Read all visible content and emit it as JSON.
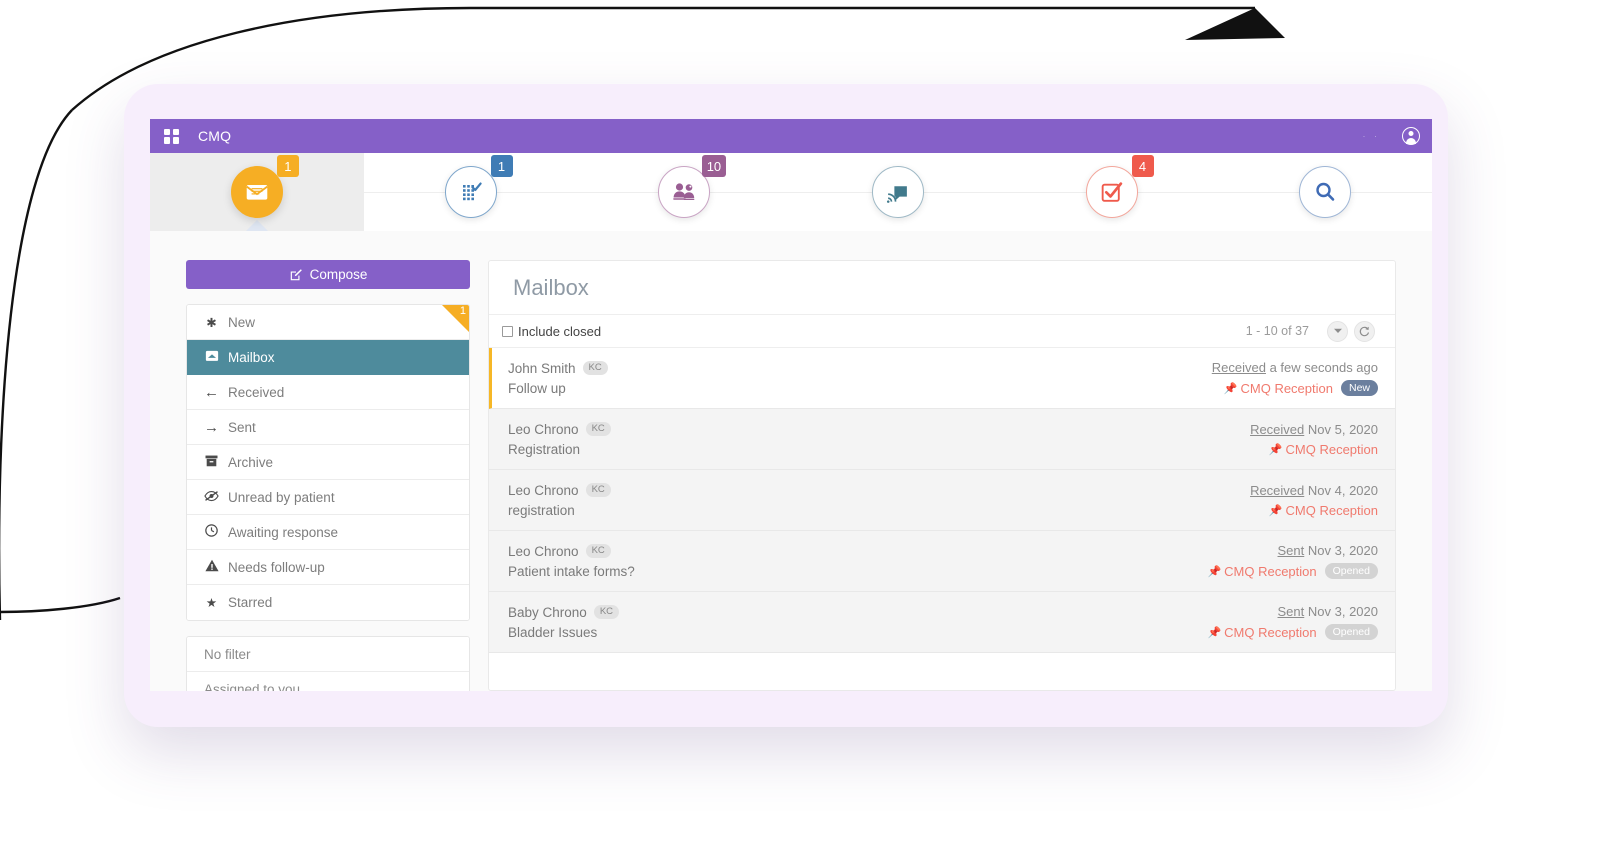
{
  "window": {
    "app_title": "CMQ",
    "menu_icon": "grid-icon",
    "dots": "· ·",
    "account_icon": "account-circle-icon"
  },
  "nav": {
    "items": [
      {
        "id": "messages",
        "icon": "envelope-icon",
        "badge": "1",
        "badge_color": "#f6ae24",
        "active": true,
        "filled": true
      },
      {
        "id": "tasks",
        "icon": "checklist-grid-icon",
        "badge": "1",
        "badge_color": "#3f7cb5",
        "active": false,
        "filled": false
      },
      {
        "id": "patients",
        "icon": "patients-icon",
        "badge": "10",
        "badge_color": "#9a5e93",
        "active": false,
        "filled": false
      },
      {
        "id": "broadcast",
        "icon": "broadcast-icon",
        "badge": "",
        "badge_color": "",
        "active": false,
        "filled": false
      },
      {
        "id": "approvals",
        "icon": "checkbox-check-icon",
        "badge": "4",
        "badge_color": "#ef5a4c",
        "active": false,
        "filled": false
      },
      {
        "id": "search",
        "icon": "search-icon",
        "badge": "",
        "badge_color": "",
        "active": false,
        "filled": false
      }
    ]
  },
  "sidebar": {
    "compose_label": "Compose",
    "compose_icon": "compose-pencil-icon",
    "folders": [
      {
        "label": "New",
        "icon": "asterisk-icon",
        "badge": "1",
        "selected": false
      },
      {
        "label": "Mailbox",
        "icon": "inbox-icon",
        "badge": "",
        "selected": true
      },
      {
        "label": "Received",
        "icon": "arrow-left-icon",
        "badge": "",
        "selected": false
      },
      {
        "label": "Sent",
        "icon": "arrow-right-icon",
        "badge": "",
        "selected": false
      },
      {
        "label": "Archive",
        "icon": "archive-box-icon",
        "badge": "",
        "selected": false
      },
      {
        "label": "Unread by patient",
        "icon": "eye-slash-icon",
        "badge": "",
        "selected": false
      },
      {
        "label": "Awaiting response",
        "icon": "clock-icon",
        "badge": "",
        "selected": false
      },
      {
        "label": "Needs follow-up",
        "icon": "warning-icon",
        "badge": "",
        "selected": false
      },
      {
        "label": "Starred",
        "icon": "star-icon",
        "badge": "",
        "selected": false
      }
    ],
    "filters": [
      {
        "label": "No filter"
      },
      {
        "label": "Assigned to you"
      }
    ]
  },
  "main": {
    "title": "Mailbox",
    "include_closed_label": "Include closed",
    "include_closed_checked": false,
    "pagination_text": "1 - 10 of 37",
    "dropdown_icon": "caret-down-icon",
    "refresh_icon": "refresh-icon",
    "messages": [
      {
        "from": "John Smith",
        "initials": "KC",
        "subject": "Follow up",
        "direction": "Received",
        "date": "a few seconds ago",
        "tag": "CMQ Reception",
        "tag_icon": "pin-icon",
        "status": "New",
        "status_type": "new",
        "unread": true
      },
      {
        "from": "Leo Chrono",
        "initials": "KC",
        "subject": "Registration",
        "direction": "Received",
        "date": "Nov 5, 2020",
        "tag": "CMQ Reception",
        "tag_icon": "pin-icon",
        "status": "",
        "status_type": "",
        "unread": false
      },
      {
        "from": "Leo Chrono",
        "initials": "KC",
        "subject": "registration",
        "direction": "Received",
        "date": "Nov 4, 2020",
        "tag": "CMQ Reception",
        "tag_icon": "pin-icon",
        "status": "",
        "status_type": "",
        "unread": false
      },
      {
        "from": "Leo Chrono",
        "initials": "KC",
        "subject": "Patient intake forms?",
        "direction": "Sent",
        "date": "Nov 3, 2020",
        "tag": "CMQ Reception",
        "tag_icon": "pin-icon",
        "status": "Opened",
        "status_type": "opened",
        "unread": false
      },
      {
        "from": "Baby Chrono",
        "initials": "KC",
        "subject": "Bladder Issues",
        "direction": "Sent",
        "date": "Nov 3, 2020",
        "tag": "CMQ Reception",
        "tag_icon": "pin-icon",
        "status": "Opened",
        "status_type": "opened",
        "unread": false
      }
    ]
  },
  "colors": {
    "brand_purple": "#8560c8",
    "accent_amber": "#f6ae24",
    "selected_teal": "#4e8b9c",
    "tag_red": "#f07a6e",
    "badge_blue": "#3f7cb5",
    "badge_plum": "#9a5e93",
    "badge_red": "#ef5a4c"
  }
}
